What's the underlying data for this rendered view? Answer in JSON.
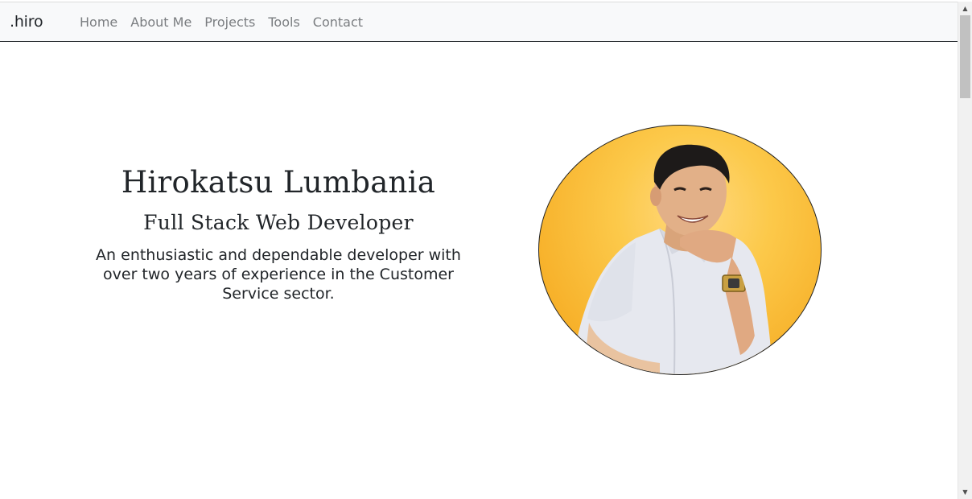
{
  "navbar": {
    "brand": ".hiro",
    "links": [
      {
        "label": "Home"
      },
      {
        "label": "About Me"
      },
      {
        "label": "Projects"
      },
      {
        "label": "Tools"
      },
      {
        "label": "Contact"
      }
    ]
  },
  "hero": {
    "name": "Hirokatsu Lumbania",
    "role": "Full Stack Web Developer",
    "description": "An enthusiastic and dependable developer with over two years of experience in the Customer Service sector."
  },
  "portrait": {
    "icon": "profile-photo",
    "background_color": "#fcc94a"
  },
  "scrollbar": {
    "up_icon": "▲",
    "down_icon": "▼"
  }
}
